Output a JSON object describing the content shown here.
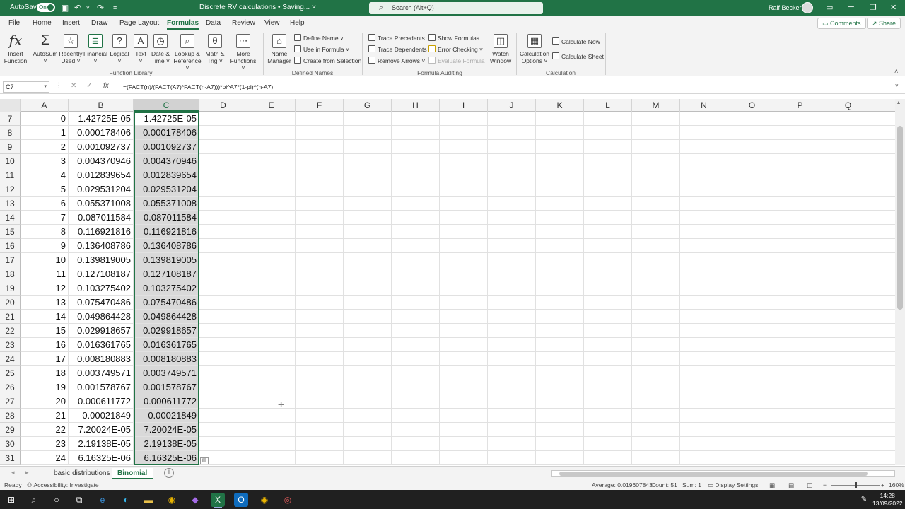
{
  "titlebar": {
    "autosave_label": "AutoSave",
    "autosave_state": "On",
    "document_title": "Discrete RV calculations • Saving... ˅",
    "search_placeholder": "Search (Alt+Q)",
    "user_name": "Ralf Becker",
    "accent_color": "#217346"
  },
  "menu": {
    "tabs": [
      "File",
      "Home",
      "Insert",
      "Draw",
      "Page Layout",
      "Formulas",
      "Data",
      "Review",
      "View",
      "Help"
    ],
    "active_tab": "Formulas",
    "comments_label": "Comments",
    "share_label": "Share"
  },
  "ribbon": {
    "insert_function": [
      "Insert",
      "Function"
    ],
    "autosum": "AutoSum",
    "recently_used": [
      "Recently",
      "Used"
    ],
    "financial": "Financial",
    "logical": "Logical",
    "text": "Text",
    "date_time": [
      "Date &",
      "Time"
    ],
    "lookup_reference": [
      "Lookup &",
      "Reference"
    ],
    "math_trig": [
      "Math &",
      "Trig"
    ],
    "more_functions": [
      "More",
      "Functions"
    ],
    "function_library_label": "Function Library",
    "name_manager": [
      "Name",
      "Manager"
    ],
    "define_name": "Define Name",
    "use_in_formula": "Use in Formula",
    "create_from_selection": "Create from Selection",
    "defined_names_label": "Defined Names",
    "trace_precedents": "Trace Precedents",
    "trace_dependents": "Trace Dependents",
    "remove_arrows": "Remove Arrows",
    "show_formulas": "Show Formulas",
    "error_checking": "Error Checking",
    "evaluate_formula": "Evaluate Formula",
    "watch_window": [
      "Watch",
      "Window"
    ],
    "formula_auditing_label": "Formula Auditing",
    "calculation_options": [
      "Calculation",
      "Options"
    ],
    "calculate_now": "Calculate Now",
    "calculate_sheet": "Calculate Sheet",
    "calculation_label": "Calculation"
  },
  "formula_bar": {
    "name_box": "C7",
    "formula": "=(FACT(n)/(FACT(A7)*FACT(n-A7)))*pi^A7*(1-pi)^(n-A7)"
  },
  "grid": {
    "columns": [
      "A",
      "B",
      "C",
      "D",
      "E",
      "F",
      "G",
      "H",
      "I",
      "J",
      "K",
      "L",
      "M",
      "N",
      "O",
      "P",
      "Q"
    ],
    "selected_column": "C",
    "rows": [
      {
        "num": "7",
        "a": "0",
        "b": "1.42725E-05",
        "c": "1.42725E-05"
      },
      {
        "num": "8",
        "a": "1",
        "b": "0.000178406",
        "c": "0.000178406"
      },
      {
        "num": "9",
        "a": "2",
        "b": "0.001092737",
        "c": "0.001092737"
      },
      {
        "num": "10",
        "a": "3",
        "b": "0.004370946",
        "c": "0.004370946"
      },
      {
        "num": "11",
        "a": "4",
        "b": "0.012839654",
        "c": "0.012839654"
      },
      {
        "num": "12",
        "a": "5",
        "b": "0.029531204",
        "c": "0.029531204"
      },
      {
        "num": "13",
        "a": "6",
        "b": "0.055371008",
        "c": "0.055371008"
      },
      {
        "num": "14",
        "a": "7",
        "b": "0.087011584",
        "c": "0.087011584"
      },
      {
        "num": "15",
        "a": "8",
        "b": "0.116921816",
        "c": "0.116921816"
      },
      {
        "num": "16",
        "a": "9",
        "b": "0.136408786",
        "c": "0.136408786"
      },
      {
        "num": "17",
        "a": "10",
        "b": "0.139819005",
        "c": "0.139819005"
      },
      {
        "num": "18",
        "a": "11",
        "b": "0.127108187",
        "c": "0.127108187"
      },
      {
        "num": "19",
        "a": "12",
        "b": "0.103275402",
        "c": "0.103275402"
      },
      {
        "num": "20",
        "a": "13",
        "b": "0.075470486",
        "c": "0.075470486"
      },
      {
        "num": "21",
        "a": "14",
        "b": "0.049864428",
        "c": "0.049864428"
      },
      {
        "num": "22",
        "a": "15",
        "b": "0.029918657",
        "c": "0.029918657"
      },
      {
        "num": "23",
        "a": "16",
        "b": "0.016361765",
        "c": "0.016361765"
      },
      {
        "num": "24",
        "a": "17",
        "b": "0.008180883",
        "c": "0.008180883"
      },
      {
        "num": "25",
        "a": "18",
        "b": "0.003749571",
        "c": "0.003749571"
      },
      {
        "num": "26",
        "a": "19",
        "b": "0.001578767",
        "c": "0.001578767"
      },
      {
        "num": "27",
        "a": "20",
        "b": "0.000611772",
        "c": "0.000611772"
      },
      {
        "num": "28",
        "a": "21",
        "b": "0.00021849",
        "c": "0.00021849"
      },
      {
        "num": "29",
        "a": "22",
        "b": "7.20024E-05",
        "c": "7.20024E-05"
      },
      {
        "num": "30",
        "a": "23",
        "b": "2.19138E-05",
        "c": "2.19138E-05"
      },
      {
        "num": "31",
        "a": "24",
        "b": "6.16325E-06",
        "c": "6.16325E-06"
      }
    ]
  },
  "sheets": {
    "tabs": [
      "basic distributions",
      "Binomial"
    ],
    "active": "Binomial"
  },
  "status": {
    "ready": "Ready",
    "accessibility": "Accessibility: Investigate",
    "average": "Average: 0.019607843",
    "count": "Count: 51",
    "sum": "Sum: 1",
    "display_settings": "Display Settings",
    "zoom": "160%"
  },
  "taskbar": {
    "time": "14:28",
    "date": "13/09/2022"
  }
}
